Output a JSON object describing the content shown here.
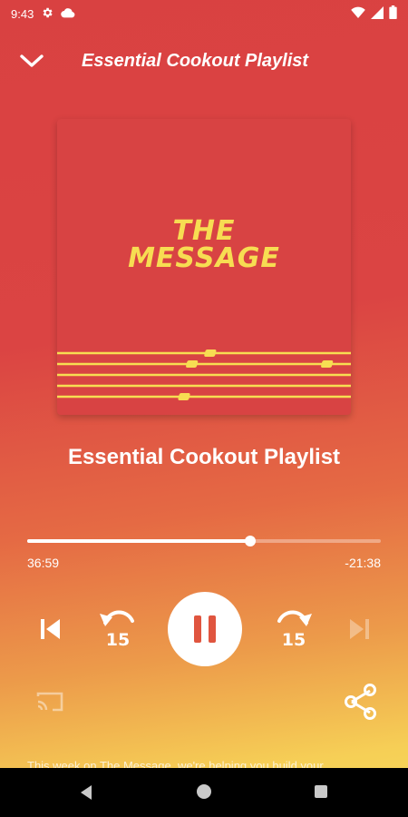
{
  "status_bar": {
    "time": "9:43",
    "icons": [
      "gear-icon",
      "cloud-icon",
      "wifi-icon",
      "signal-icon",
      "battery-icon"
    ]
  },
  "header": {
    "title": "Essential Cookout Playlist",
    "collapse_icon": "chevron-down-icon"
  },
  "artwork": {
    "line1": "THE",
    "line2": "MESSAGE",
    "background_color": "#d84343",
    "text_color": "#f7dd52"
  },
  "track": {
    "title": "Essential Cookout Playlist"
  },
  "playback": {
    "elapsed": "36:59",
    "remaining": "-21:38",
    "progress_fraction": 0.63,
    "state": "playing"
  },
  "controls": {
    "previous_icon": "skip-previous-icon",
    "rewind_label": "15",
    "rewind_icon": "replay-15-icon",
    "play_pause_icon": "pause-icon",
    "forward_label": "15",
    "forward_icon": "forward-15-icon",
    "next_icon": "skip-next-icon",
    "cast_icon": "cast-icon",
    "share_icon": "share-icon"
  },
  "description": "This week on The Message, we're helping you build your",
  "nav_bar": {
    "icons": [
      "back-icon",
      "home-icon",
      "recents-icon"
    ]
  },
  "colors": {
    "gradient_top": "#d94141",
    "gradient_bottom": "#f9dc5c",
    "accent_yellow": "#f7dd52"
  }
}
